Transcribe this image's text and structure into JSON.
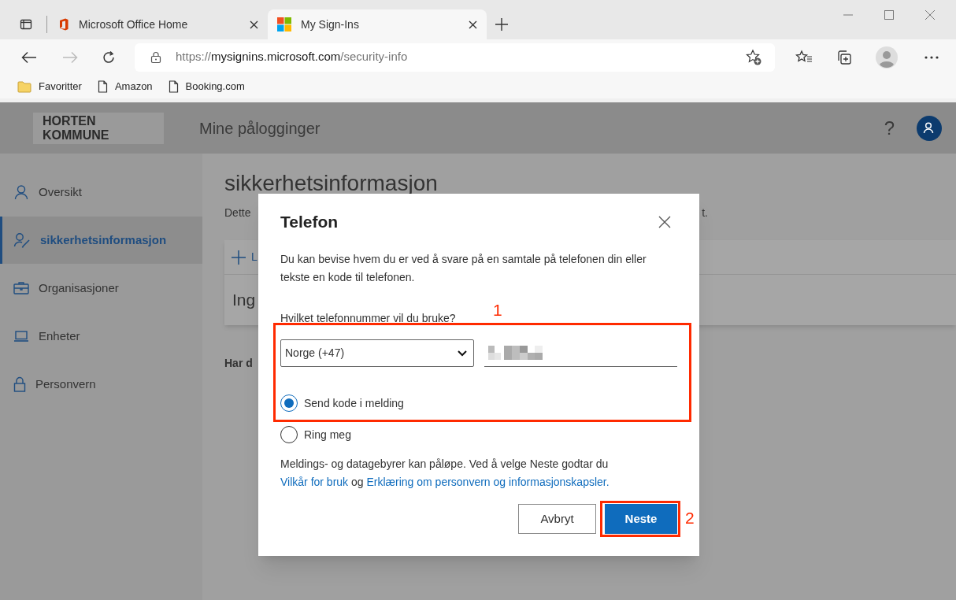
{
  "browser": {
    "tabs": [
      {
        "title": "Microsoft Office Home",
        "kind": "office",
        "selected": false
      },
      {
        "title": "My Sign-Ins",
        "kind": "windows",
        "selected": true
      }
    ],
    "address": {
      "scheme": "https://",
      "host": "mysignins.microsoft.com",
      "path": "/security-info"
    },
    "bookmarks": [
      {
        "label": "Favoritter",
        "kind": "folder"
      },
      {
        "label": "Amazon",
        "kind": "page"
      },
      {
        "label": "Booking.com",
        "kind": "page"
      }
    ]
  },
  "header": {
    "logo_lines": [
      "HORTEN",
      "KOMMUNE"
    ],
    "title": "Mine pålogginger",
    "help": "?"
  },
  "sidebar": {
    "items": [
      {
        "label": "Oversikt",
        "kind": "person",
        "selected": false
      },
      {
        "label": "sikkerhetsinformasjon",
        "kind": "person-pen",
        "selected": true
      },
      {
        "label": "Organisasjoner",
        "kind": "briefcase",
        "selected": false
      },
      {
        "label": "Enheter",
        "kind": "laptop",
        "selected": false
      },
      {
        "label": "Personvern",
        "kind": "lock",
        "selected": false
      }
    ]
  },
  "page": {
    "heading": "sikkerhetsinformasjon",
    "description_start": "Dette",
    "description_end": "t.",
    "add_method": "L",
    "empty_text": "Ing",
    "footer_text": "Har d"
  },
  "dialog": {
    "title": "Telefon",
    "intro": "Du kan bevise hvem du er ved å svare på en samtale på telefonen din eller tekste en kode til telefonen.",
    "question": "Hvilket telefonnummer vil du bruke?",
    "country": "Norge (+47)",
    "options": [
      {
        "label": "Send kode i melding",
        "selected": true
      },
      {
        "label": "Ring meg",
        "selected": false
      }
    ],
    "notice": "Meldings- og datagebyrer kan påløpe. Ved å velge Neste godtar du",
    "link_terms": "Vilkår for bruk",
    "connector": "og",
    "link_privacy": "Erklæring om personvern og informasjonskapsler.",
    "buttons": [
      {
        "label": "Avbryt",
        "kind": "secondary"
      },
      {
        "label": "Neste",
        "kind": "primary"
      }
    ]
  },
  "annotations": [
    {
      "label": "1"
    },
    {
      "label": "2"
    }
  ]
}
